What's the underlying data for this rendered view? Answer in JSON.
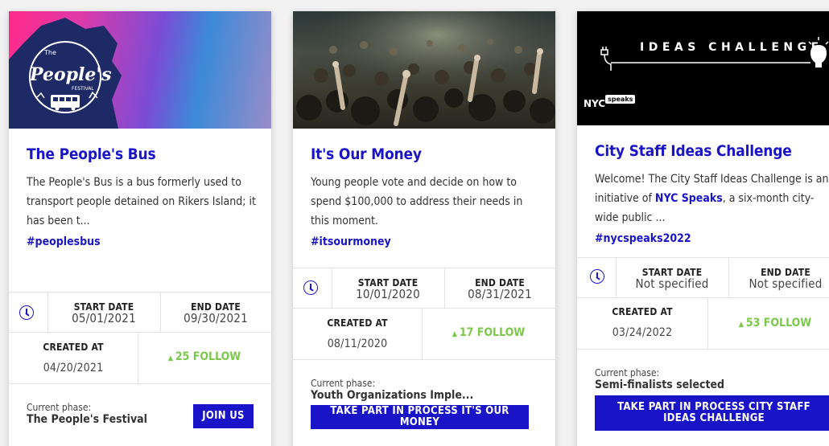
{
  "colors": {
    "primary": "#1a14c8",
    "follow": "#7bc84a",
    "text": "#333333"
  },
  "cards": [
    {
      "title": "The People's Bus",
      "description": "The People's Bus is a bus formerly used to transport people detained on Rikers Island; it has been t...",
      "hashtag": "#peoplesbus",
      "image_icon": "peoples-festival-logo",
      "start_date_label": "START DATE",
      "start_date": "05/01/2021",
      "end_date_label": "END DATE",
      "end_date": "09/30/2021",
      "created_label": "CREATED AT",
      "created_at": "04/20/2021",
      "follow": "25 FOLLOW",
      "phase_label": "Current phase:",
      "phase": "The People's Festival",
      "button": "JOIN US",
      "logo_text_small": "The",
      "logo_text": "People's",
      "logo_text_sub": "FESTIVAL"
    },
    {
      "title": "It's Our Money",
      "description": "Young people vote and decide on how to spend $100,000 to address their needs in this moment.",
      "hashtag": "#itsourmoney",
      "image_icon": "crowd-photo",
      "start_date_label": "START DATE",
      "start_date": "10/01/2020",
      "end_date_label": "END DATE",
      "end_date": "08/31/2021",
      "created_label": "CREATED AT",
      "created_at": "08/11/2020",
      "follow": "17 FOLLOW",
      "phase_label": "Current phase:",
      "phase": "Youth Organizations Imple...",
      "button": "TAKE PART IN PROCESS IT'S OUR MONEY"
    },
    {
      "title": "City Staff Ideas Challenge",
      "description_pre": "Welcome! The City Staff Ideas Challenge is an initiative of ",
      "description_link": "NYC Speaks",
      "description_post": ", a six-month city-wide public ...",
      "hashtag": "#nycspeaks2022",
      "image_icon": "ideas-challenge-banner",
      "image_title": "IDEAS CHALLENGE",
      "image_nyc": "NYC",
      "image_speaks": "speaks",
      "start_date_label": "START DATE",
      "start_date": "Not specified",
      "end_date_label": "END DATE",
      "end_date": "Not specified",
      "created_label": "CREATED AT",
      "created_at": "03/24/2022",
      "follow": "53 FOLLOW",
      "phase_label": "Current phase:",
      "phase": "Semi-finalists selected",
      "button": "TAKE PART IN PROCESS CITY STAFF IDEAS CHALLENGE"
    }
  ]
}
